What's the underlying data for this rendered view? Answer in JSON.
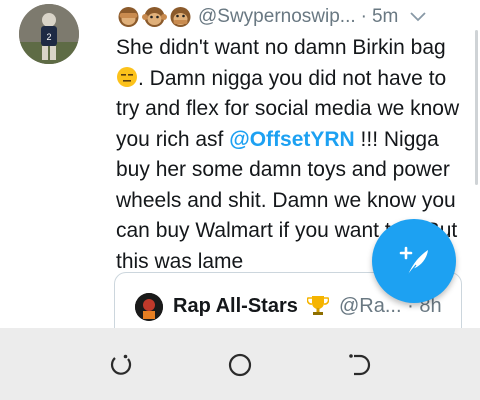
{
  "tweet": {
    "emojis": [
      "see-no-evil-monkey-emoji",
      "hear-no-evil-monkey-emoji",
      "speak-no-evil-monkey-emoji"
    ],
    "handle": "@Swypernoswip...",
    "separator": "·",
    "time": "5m",
    "text_part1": "She didn't want no damn Birkin bag ",
    "text_part2": ". Damn nigga you did not have to try and flex for social media we know you rich asf ",
    "mention": "@OffsetYRN",
    "text_part3": " !!! Nigga buy her some damn toys and power wheels and shit. Damn we know you can buy Walmart if you want too. But this was lame",
    "inline_emoji": "expressionless-face-emoji"
  },
  "quoted": {
    "name": "Rap All-Stars",
    "badge_icon": "trophy-emoji",
    "handle": "@Ra...",
    "separator": "·",
    "time": "8h"
  },
  "compose_button": {
    "icon": "compose-tweet-icon"
  },
  "system_nav": {
    "recent_icon": "recent-apps-icon",
    "home_icon": "home-icon",
    "back_icon": "back-icon"
  },
  "colors": {
    "accent": "#1da1f2",
    "text": "#14171a",
    "secondary_text": "#697882",
    "navbar": "#ececec"
  }
}
